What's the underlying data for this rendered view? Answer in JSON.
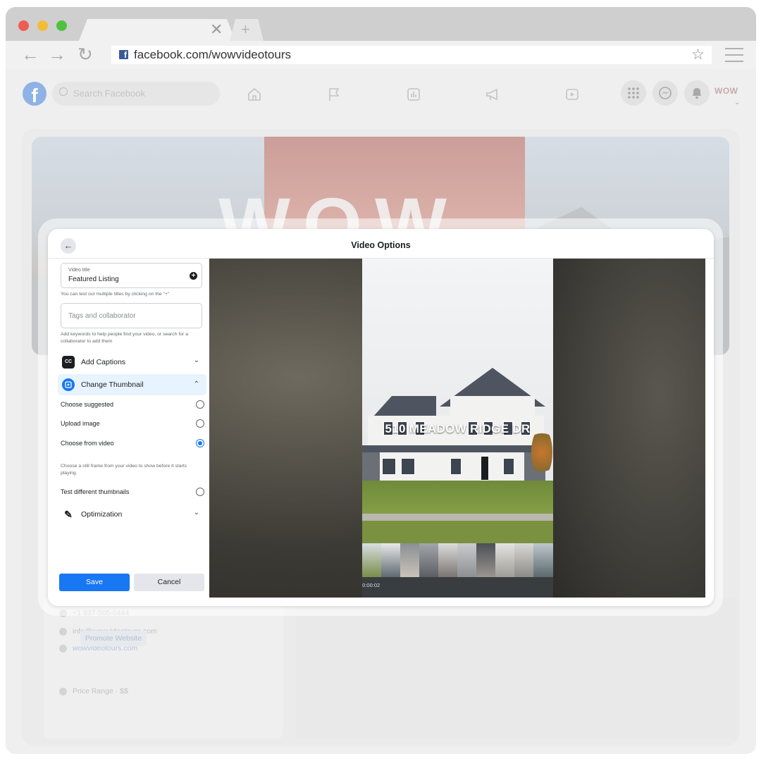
{
  "browser": {
    "url": "facebook.com/wowvideotours",
    "traffic_lights": [
      "#ee5c54",
      "#f4bc35",
      "#4fc13f"
    ]
  },
  "facebook": {
    "search_placeholder": "Search Facebook",
    "logo_text": "f",
    "profile_logo": "WOW",
    "cover_word": "WOW",
    "contact": {
      "phone": "+1 937-505-0444",
      "email": "info@wowvideotours.com",
      "website": "wowvideotours.com",
      "promote_label": "Promote Website",
      "price_range": "Price Range · $$"
    }
  },
  "modal": {
    "title": "Video Options",
    "video_title_label": "Video title",
    "video_title_value": "Featured Listing",
    "title_hint": "You can test out multiple titles by clicking on the \"+\"",
    "tags_placeholder": "Tags and collaborator",
    "tags_hint": "Add keywords to help people find your video, or search for a collaborator to add them",
    "sections": {
      "captions": "Add Captions",
      "captions_icon": "CC",
      "thumbnail": "Change Thumbnail",
      "optimization": "Optimization"
    },
    "thumbnail_options": {
      "suggested": "Choose suggested",
      "upload": "Upload image",
      "from_video": "Choose from video",
      "selected": "from_video",
      "from_video_hint": "Choose a still frame from your video to show before it starts playing.",
      "test_different": "Test different thumbnails"
    },
    "buttons": {
      "save": "Save",
      "cancel": "Cancel"
    },
    "video": {
      "address": "510 MEADOW RIDGE DR",
      "timecode": "00:00:02"
    }
  },
  "colors": {
    "facebook_blue": "#1877f2",
    "dark_text": "#1c1e21"
  }
}
